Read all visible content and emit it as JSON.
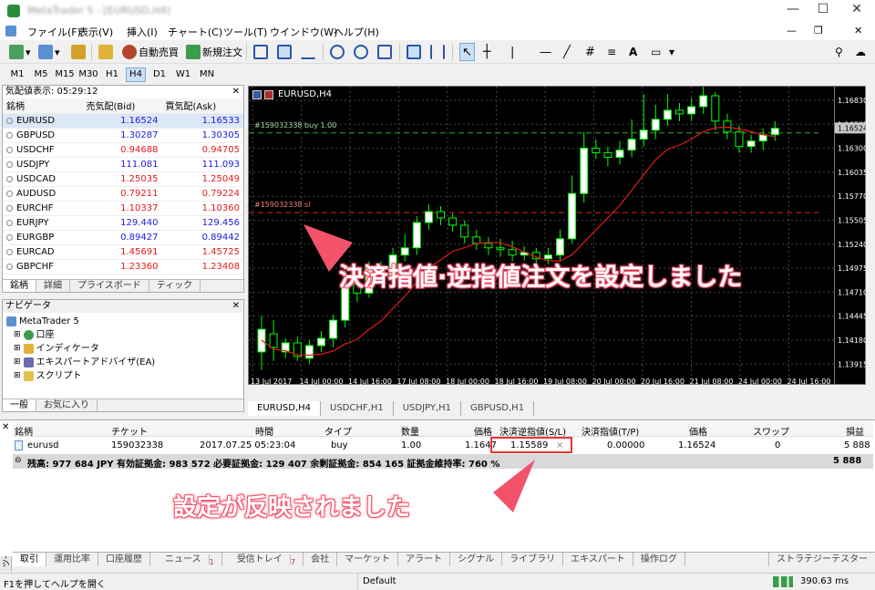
{
  "window": {
    "title": "MetaTrader 5 - [EURUSD,H4]",
    "min": "—",
    "max": "☐",
    "close": "✕"
  },
  "menu": [
    "ファイル(F)",
    "表示(V)",
    "挿入(I)",
    "チャート(C)",
    "ツール(T)",
    "ウインドウ(W)",
    "ヘルプ(H)"
  ],
  "toolbar": {
    "auto_trade": "自動売買",
    "new_order": "新規注文"
  },
  "timeframes": [
    "M1",
    "M5",
    "M15",
    "M30",
    "H1",
    "H4",
    "D1",
    "W1",
    "MN"
  ],
  "active_timeframe": "H4",
  "market_watch": {
    "title": "気配値表示: 05:29:12",
    "headers": {
      "symbol": "銘柄",
      "bid": "売気配(Bid)",
      "ask": "買気配(Ask)"
    },
    "rows": [
      {
        "symbol": "EURUSD",
        "bid": "1.16524",
        "ask": "1.16533",
        "dir": "up"
      },
      {
        "symbol": "GBPUSD",
        "bid": "1.30287",
        "ask": "1.30305",
        "dir": "up"
      },
      {
        "symbol": "USDCHF",
        "bid": "0.94688",
        "ask": "0.94705",
        "dir": "down"
      },
      {
        "symbol": "USDJPY",
        "bid": "111.081",
        "ask": "111.093",
        "dir": "up"
      },
      {
        "symbol": "USDCAD",
        "bid": "1.25035",
        "ask": "1.25049",
        "dir": "down"
      },
      {
        "symbol": "AUDUSD",
        "bid": "0.79211",
        "ask": "0.79224",
        "dir": "down"
      },
      {
        "symbol": "EURCHF",
        "bid": "1.10337",
        "ask": "1.10360",
        "dir": "down"
      },
      {
        "symbol": "EURJPY",
        "bid": "129.440",
        "ask": "129.456",
        "dir": "up"
      },
      {
        "symbol": "EURGBP",
        "bid": "0.89427",
        "ask": "0.89442",
        "dir": "up"
      },
      {
        "symbol": "EURCAD",
        "bid": "1.45691",
        "ask": "1.45725",
        "dir": "down"
      },
      {
        "symbol": "GBPCHF",
        "bid": "1.23360",
        "ask": "1.23408",
        "dir": "down"
      }
    ],
    "tabs": [
      "銘柄",
      "詳細",
      "プライスボード",
      "ティック"
    ]
  },
  "navigator": {
    "title": "ナビゲータ",
    "items": [
      "MetaTrader 5",
      "口座",
      "インディケータ",
      "エキスパートアドバイザ(EA)",
      "スクリプト"
    ],
    "tabs": [
      "一般",
      "お気に入り"
    ]
  },
  "chart": {
    "label": "EURUSD,H4",
    "order_label_tp": "#159032338 buy 1.00",
    "order_label_sl": "#159032338 sl",
    "price_ticks": [
      "1.16830",
      "1.16565",
      "1.16300",
      "1.16035",
      "1.15770",
      "1.15505",
      "1.15240",
      "1.14975",
      "1.14710",
      "1.14445",
      "1.14180",
      "1.13915"
    ],
    "current_price": "1.16524",
    "time_ticks": [
      "13 Jul 2017",
      "14 Jul 00:00",
      "14 Jul 16:00",
      "17 Jul 08:00",
      "18 Jul 00:00",
      "18 Jul 16:00",
      "19 Jul 08:00",
      "20 Jul 00:00",
      "20 Jul 16:00",
      "21 Jul 08:00",
      "24 Jul 00:00",
      "24 Jul 16:00"
    ],
    "tabs": [
      "EURUSD,H4",
      "USDCHF,H1",
      "USDJPY,H1",
      "GBPUSD,H1"
    ],
    "callout": "決済指値·逆指値注文を設定しました"
  },
  "terminal": {
    "headers": [
      "銘柄",
      "チケット",
      "時間",
      "タイプ",
      "数量",
      "価格",
      "決済逆指値(S/L)",
      "決済指値(T/P)",
      "価格",
      "スワップ",
      "損益"
    ],
    "row": [
      "eurusd",
      "159032338",
      "2017.07.25 05:23:04",
      "buy",
      "1.00",
      "1.1647",
      "1.15589",
      "0.00000",
      "1.16524",
      "0",
      "5 888"
    ],
    "balance": "残高: 977 684 JPY  有効証拠金: 983 572  必要証拠金: 129 407  余剰証拠金: 854 165  証拠金維持率: 760 %",
    "balance_profit": "5 888",
    "callout": "設定が反映されました",
    "tabs": [
      "取引",
      "運用比率",
      "口座履歴",
      "ニュース",
      "受信トレイ",
      "会社",
      "マーケット",
      "アラート",
      "シグナル",
      "ライブラリ",
      "エキスパート",
      "操作ログ"
    ],
    "tab_news_badge": "1",
    "tab_inbox_badge": "7",
    "strategy_tester": "ストラテジーテスター",
    "side_label": "ツールボックス"
  },
  "status": {
    "help": "F1を押してヘルプを開く",
    "profile": "Default",
    "ping": "390.63 ms"
  },
  "colors": {
    "bull": "#ffffff",
    "bear": "#00ff00",
    "ma": "#e31b1b",
    "tp_line": "#2fa82f",
    "sl_line": "#d42525",
    "callout": "#f2536b"
  }
}
